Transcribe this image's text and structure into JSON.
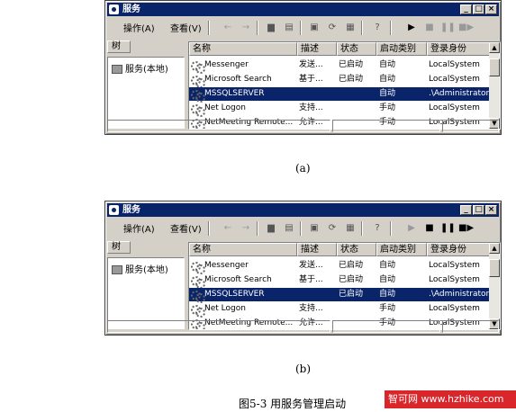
{
  "windows": [
    {
      "id": "a",
      "title": "服务",
      "menu": [
        "操作(A)",
        "查看(V)"
      ],
      "tree_tab": "树",
      "tree_node": "服务(本地)",
      "columns": [
        "名称",
        "描述",
        "状态",
        "启动类别",
        "登录身份"
      ],
      "rows": [
        {
          "name": "Messenger",
          "desc": "发送...",
          "status": "已启动",
          "startup": "自动",
          "logon": "LocalSystem"
        },
        {
          "name": "Microsoft Search",
          "desc": "基于...",
          "status": "已启动",
          "startup": "自动",
          "logon": "LocalSystem"
        },
        {
          "name": "MSSQLSERVER",
          "desc": "",
          "status": "",
          "startup": "自动",
          "logon": ".\\Administrator"
        },
        {
          "name": "Net Logon",
          "desc": "支持...",
          "status": "",
          "startup": "手动",
          "logon": "LocalSystem"
        },
        {
          "name": "NetMeeting Remote...",
          "desc": "允许...",
          "status": "",
          "startup": "手动",
          "logon": "LocalSystem"
        }
      ],
      "label": "(a)"
    },
    {
      "id": "b",
      "title": "服务",
      "menu": [
        "操作(A)",
        "查看(V)"
      ],
      "tree_tab": "树",
      "tree_node": "服务(本地)",
      "columns": [
        "名称",
        "描述",
        "状态",
        "启动类别",
        "登录身份"
      ],
      "rows": [
        {
          "name": "Messenger",
          "desc": "发送...",
          "status": "已启动",
          "startup": "自动",
          "logon": "LocalSystem"
        },
        {
          "name": "Microsoft Search",
          "desc": "基于...",
          "status": "已启动",
          "startup": "自动",
          "logon": "LocalSystem"
        },
        {
          "name": "MSSQLSERVER",
          "desc": "",
          "status": "已启动",
          "startup": "自动",
          "logon": ".\\Administrator"
        },
        {
          "name": "Net Logon",
          "desc": "支持...",
          "status": "",
          "startup": "手动",
          "logon": "LocalSystem"
        },
        {
          "name": "NetMeeting Remote...",
          "desc": "允许...",
          "status": "",
          "startup": "手动",
          "logon": "LocalSystem"
        }
      ],
      "label": "(b)"
    }
  ],
  "figure_caption": "图5-3 用服务管理启动",
  "watermark": "智可网 www.hzhike.com"
}
